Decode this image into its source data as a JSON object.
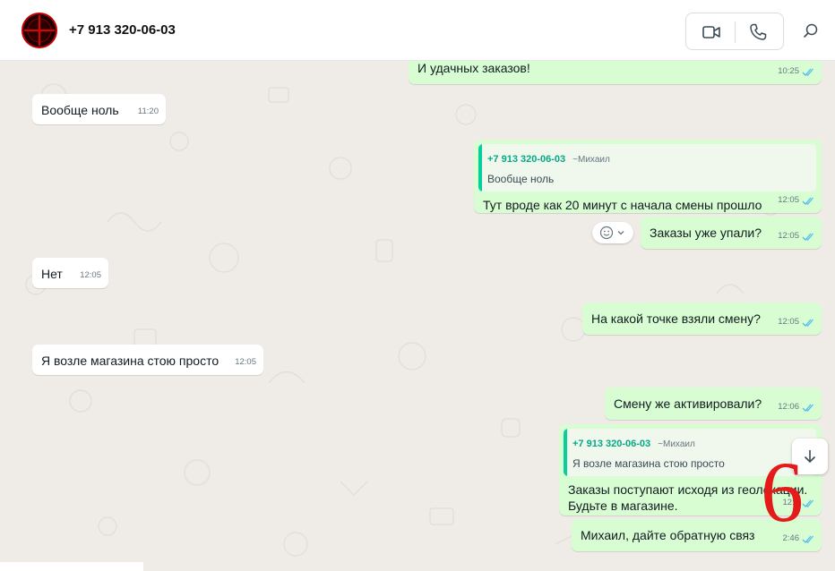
{
  "header": {
    "contact_name": "+7 913 320-06-03",
    "video_icon": "video-camera-icon",
    "phone_icon": "phone-icon",
    "search_icon": "search-icon"
  },
  "messages": [
    {
      "direction": "out",
      "text": "И удачных заказов!",
      "time": "10:25",
      "read": true
    },
    {
      "direction": "in",
      "text": "Вообще ноль",
      "time": "11:20"
    },
    {
      "direction": "out",
      "quote": {
        "name": "+7 913 320-06-03",
        "alias": "~Михаил",
        "text": "Вообще ноль"
      },
      "text": "Тут вроде как 20 минут с начала смены прошло",
      "time": "12:05",
      "read": true
    },
    {
      "direction": "out",
      "text": "Заказы уже упали?",
      "time": "12:05",
      "read": true
    },
    {
      "direction": "in",
      "text": "Нет",
      "time": "12:05"
    },
    {
      "direction": "out",
      "text": "На какой точке взяли смену?",
      "time": "12:05",
      "read": true
    },
    {
      "direction": "in",
      "text": "Я возле магазина стою просто",
      "time": "12:05"
    },
    {
      "direction": "out",
      "text": "Смену же активировали?",
      "time": "12:06",
      "read": true
    },
    {
      "direction": "out",
      "quote": {
        "name": "+7 913 320-06-03",
        "alias": "~Михаил",
        "text": "Я возле магазина стою просто"
      },
      "text": "Заказы поступают исходя из геолокации. Будьте в магазине.",
      "time": "12:4",
      "read": true
    },
    {
      "direction": "out",
      "text": "Михаил, дайте обратную связ",
      "time": "2:46",
      "read": true
    }
  ],
  "reaction_button": {
    "icon": "emoji-icon",
    "chevron": "chevron-down-icon"
  },
  "scroll_button": {
    "icon": "arrow-down-icon"
  },
  "annotation": {
    "label": "6",
    "color": "#e41b1b"
  },
  "colors": {
    "incoming": "#ffffff",
    "outgoing": "#d9fdd3",
    "tick": "#53bdeb",
    "quote_accent": "#06cf9c"
  }
}
